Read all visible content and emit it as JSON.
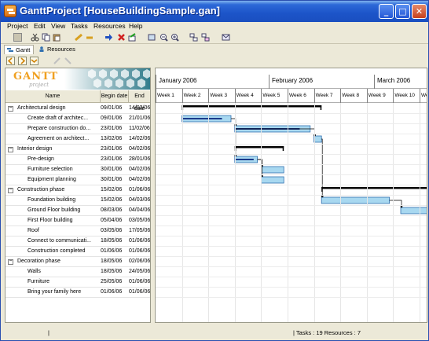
{
  "window": {
    "title": "GanttProject [HouseBuildingSample.gan]"
  },
  "window_buttons": {
    "minimize": "_",
    "maximize": "□",
    "close": "✕"
  },
  "menu": [
    "Project",
    "Edit",
    "View",
    "Tasks",
    "Resources",
    "Help"
  ],
  "tabs": [
    "Gantt",
    "Resources"
  ],
  "logo": {
    "main": "GANTT",
    "sub": "project"
  },
  "columns": {
    "name": "Name",
    "begin": "Begin date",
    "end": "End date"
  },
  "tasks": [
    {
      "name": "Architectural design",
      "begin": "09/01/06",
      "end": "14/02/06",
      "level": 0,
      "group": true
    },
    {
      "name": "Create draft of architec...",
      "begin": "09/01/06",
      "end": "21/01/06",
      "level": 1
    },
    {
      "name": "Prepare construction do...",
      "begin": "23/01/06",
      "end": "11/02/06",
      "level": 1
    },
    {
      "name": "Agreement on architect...",
      "begin": "13/02/06",
      "end": "14/02/06",
      "level": 1
    },
    {
      "name": "Interior design",
      "begin": "23/01/06",
      "end": "04/02/06",
      "level": 0,
      "group": true
    },
    {
      "name": "Pre-design",
      "begin": "23/01/06",
      "end": "28/01/06",
      "level": 1
    },
    {
      "name": "Furniture selection",
      "begin": "30/01/06",
      "end": "04/02/06",
      "level": 1
    },
    {
      "name": "Equipment planning",
      "begin": "30/01/06",
      "end": "04/02/06",
      "level": 1
    },
    {
      "name": "Construction phase",
      "begin": "15/02/06",
      "end": "01/06/06",
      "level": 0,
      "group": true
    },
    {
      "name": "Foundation building",
      "begin": "15/02/06",
      "end": "04/03/06",
      "level": 1
    },
    {
      "name": "Ground Floor building",
      "begin": "08/03/06",
      "end": "04/04/06",
      "level": 1
    },
    {
      "name": "First Floor building",
      "begin": "05/04/06",
      "end": "03/05/06",
      "level": 1
    },
    {
      "name": "Roof",
      "begin": "03/05/06",
      "end": "17/05/06",
      "level": 1
    },
    {
      "name": "Connect to communicati...",
      "begin": "18/05/06",
      "end": "01/06/06",
      "level": 1
    },
    {
      "name": "Construction completed",
      "begin": "01/06/06",
      "end": "01/06/06",
      "level": 1
    },
    {
      "name": "Decoration phase",
      "begin": "18/05/06",
      "end": "02/06/06",
      "level": 0,
      "group": true
    },
    {
      "name": "Walls",
      "begin": "18/05/06",
      "end": "24/05/06",
      "level": 1
    },
    {
      "name": "Furniture",
      "begin": "25/05/06",
      "end": "01/06/06",
      "level": 1
    },
    {
      "name": "Bring your family here",
      "begin": "01/06/06",
      "end": "01/06/06",
      "level": 1
    }
  ],
  "timeline": {
    "months": [
      "January 2006",
      "February 2006",
      "March 2006"
    ],
    "weeks": [
      "Week 1",
      "Week 2",
      "Week 3",
      "Week 4",
      "Week 5",
      "Week 6",
      "Week 7",
      "Week 8",
      "Week 9",
      "Week 10",
      "Week"
    ]
  },
  "colors": {
    "task_bar": "#a8d8f0",
    "task_border": "#3070b0",
    "summary_bar": "#000000",
    "progress": "#1a3a8a",
    "title_blue": "#1c54c8"
  },
  "status": {
    "left": "|",
    "tasks": "| Tasks : 19  Resources : 7"
  }
}
